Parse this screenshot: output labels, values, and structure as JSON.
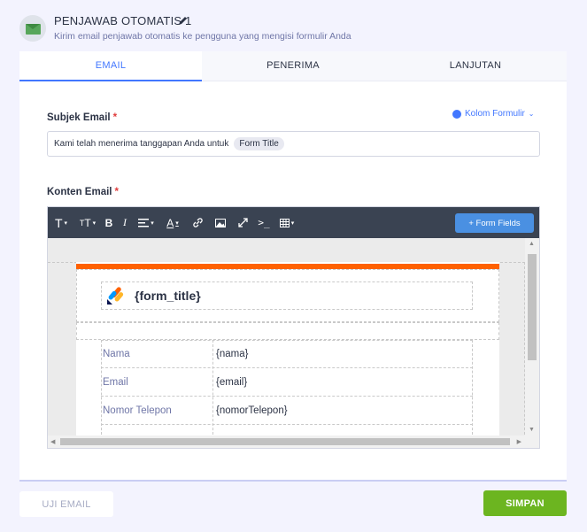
{
  "header": {
    "title": "PENJAWAB OTOMATIS 1",
    "subtitle": "Kirim email penjawab otomatis ke pengguna yang mengisi formulir Anda"
  },
  "tabs": [
    {
      "label": "EMAIL",
      "active": true
    },
    {
      "label": "PENERIMA",
      "active": false
    },
    {
      "label": "LANJUTAN",
      "active": false
    }
  ],
  "subject": {
    "label": "Subjek Email",
    "required": "*",
    "form_fields_link": "Kolom Formulir",
    "text": "Kami telah menerima tanggapan Anda untuk",
    "chip": "Form Title"
  },
  "content": {
    "label": "Konten Email",
    "required": "*"
  },
  "toolbar": {
    "items": [
      "T",
      "TT",
      "B",
      "I",
      "align",
      "A",
      "link",
      "image",
      "expand",
      "code",
      "table"
    ],
    "form_fields_button": "+ Form Fields"
  },
  "email_body": {
    "form_title": "{form_title}",
    "accent_color": "#ff6100",
    "rows": [
      {
        "label": "Nama",
        "value": "{nama}"
      },
      {
        "label": "Email",
        "value": "{email}"
      },
      {
        "label": "Nomor Telepon",
        "value": "{nomorTelepon}"
      }
    ]
  },
  "footer": {
    "test_button": "UJI EMAIL",
    "save_button": "SIMPAN"
  },
  "colors": {
    "brand_blue": "#4277ff",
    "save_green": "#6cb520",
    "toolbar_bg": "#3a4352"
  }
}
